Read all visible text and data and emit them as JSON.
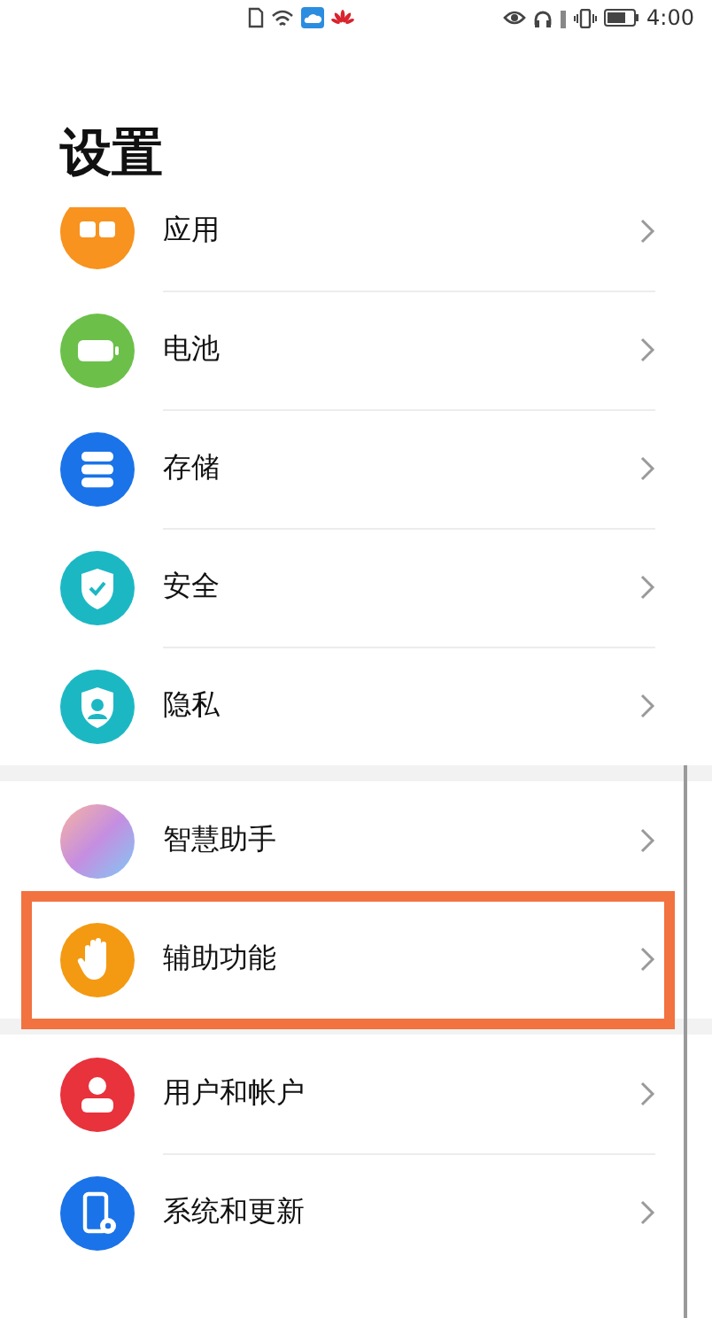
{
  "status_bar": {
    "time": "4:00"
  },
  "title": "设置",
  "groups": [
    {
      "items": [
        {
          "label": "应用",
          "kind": "apps",
          "highlighted": false
        },
        {
          "label": "电池",
          "kind": "battery",
          "highlighted": false
        },
        {
          "label": "存储",
          "kind": "storage",
          "highlighted": false
        },
        {
          "label": "安全",
          "kind": "security",
          "highlighted": false
        },
        {
          "label": "隐私",
          "kind": "privacy",
          "highlighted": false
        }
      ]
    },
    {
      "items": [
        {
          "label": "智慧助手",
          "kind": "assistant",
          "highlighted": false
        },
        {
          "label": "辅助功能",
          "kind": "accessibility",
          "highlighted": true
        }
      ]
    },
    {
      "items": [
        {
          "label": "用户和帐户",
          "kind": "account",
          "highlighted": false
        },
        {
          "label": "系统和更新",
          "kind": "system",
          "highlighted": false
        }
      ]
    }
  ]
}
